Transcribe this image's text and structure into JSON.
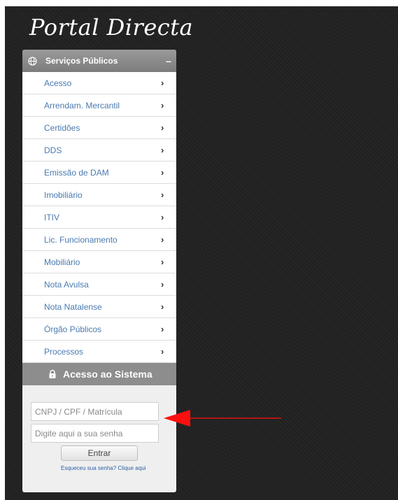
{
  "logo": {
    "text": "Portal Directa"
  },
  "panel": {
    "header_title": "Serviços Públicos",
    "collapse_symbol": "–",
    "menu_items": [
      {
        "label": "Acesso"
      },
      {
        "label": "Arrendam. Mercantil"
      },
      {
        "label": "Certidões"
      },
      {
        "label": "DDS"
      },
      {
        "label": "Emissão de DAM"
      },
      {
        "label": "Imobiliário"
      },
      {
        "label": "ITIV"
      },
      {
        "label": "Lic. Funcionamento"
      },
      {
        "label": "Mobiliário"
      },
      {
        "label": "Nota Avulsa"
      },
      {
        "label": "Nota Natalense"
      },
      {
        "label": "Órgão Públicos"
      },
      {
        "label": "Processos"
      }
    ],
    "chevron": "›",
    "access_title": "Acesso ao Sistema"
  },
  "login": {
    "user_placeholder": "CNPJ / CPF / Matrícula",
    "password_placeholder": "Digite aqui a sua senha",
    "submit_label": "Entrar",
    "forgot_text": "Esqueceu sua senha? Clique aqui"
  },
  "icons": {
    "globe": "globe-icon",
    "lock": "lock-icon",
    "chevron": "chevron-right-icon",
    "annotation": "red-arrow-annotation"
  },
  "colors": {
    "background": "#222222",
    "header": "#8a8a8a",
    "link": "#4a7ab0",
    "arrow": "#ff0000"
  }
}
